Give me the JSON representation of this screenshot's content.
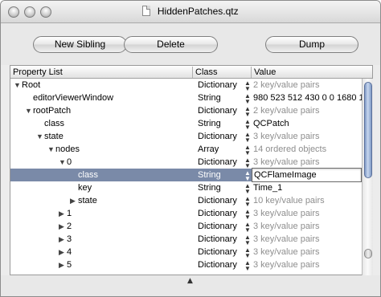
{
  "window": {
    "title": "HiddenPatches.qtz",
    "buttons": {
      "close": "close",
      "minimize": "minimize",
      "zoom": "zoom"
    }
  },
  "toolbar": {
    "new_sibling_label": "New Sibling",
    "delete_label": "Delete",
    "dump_label": "Dump"
  },
  "table": {
    "columns": [
      "Property List",
      "Class",
      "Value"
    ],
    "rows": [
      {
        "name": "Root",
        "expander": "▼",
        "class": "Dictionary",
        "value": "2 key/value pairs",
        "value_gray": true
      },
      {
        "name": "editorViewerWindow",
        "expander": "",
        "class": "String",
        "value": "980 523 512 430 0 0 1680 1",
        "value_gray": false
      },
      {
        "name": "rootPatch",
        "expander": "▼",
        "class": "Dictionary",
        "value": "2 key/value pairs",
        "value_gray": true
      },
      {
        "name": "class",
        "expander": "",
        "class": "String",
        "value": "QCPatch",
        "value_gray": false
      },
      {
        "name": "state",
        "expander": "▼",
        "class": "Dictionary",
        "value": "3 key/value pairs",
        "value_gray": true
      },
      {
        "name": "nodes",
        "expander": "▼",
        "class": "Array",
        "value": "14 ordered objects",
        "value_gray": true
      },
      {
        "name": "0",
        "expander": "▼",
        "class": "Dictionary",
        "value": "3 key/value pairs",
        "value_gray": true
      },
      {
        "name": "class",
        "expander": "",
        "class": "String",
        "value": "QCFlameImage",
        "value_gray": false,
        "selected": true
      },
      {
        "name": "key",
        "expander": "",
        "class": "String",
        "value": "Time_1",
        "value_gray": false
      },
      {
        "name": "state",
        "expander": "▶",
        "class": "Dictionary",
        "value": "10 key/value pairs",
        "value_gray": true
      },
      {
        "name": "1",
        "expander": "▶",
        "class": "Dictionary",
        "value": "3 key/value pairs",
        "value_gray": true
      },
      {
        "name": "2",
        "expander": "▶",
        "class": "Dictionary",
        "value": "3 key/value pairs",
        "value_gray": true
      },
      {
        "name": "3",
        "expander": "▶",
        "class": "Dictionary",
        "value": "3 key/value pairs",
        "value_gray": true
      },
      {
        "name": "4",
        "expander": "▶",
        "class": "Dictionary",
        "value": "3 key/value pairs",
        "value_gray": true
      },
      {
        "name": "5",
        "expander": "▶",
        "class": "Dictionary",
        "value": "3 key/value pairs",
        "value_gray": true
      }
    ]
  },
  "icons": {
    "stepper": "up-down-stepper-icon",
    "document": "document-icon",
    "resize": "split-grip-icon"
  },
  "colors": {
    "selection": "#7a8aa8",
    "scroll_thumb": "#7f9ac6"
  }
}
